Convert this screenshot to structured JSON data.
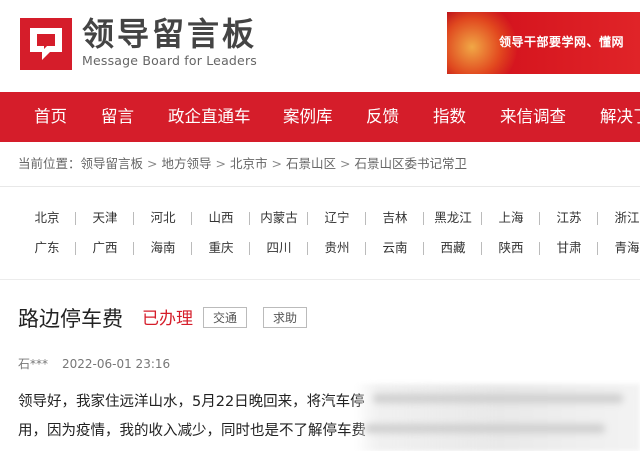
{
  "header": {
    "brand_name": "领导留言板",
    "brand_sub": "Message Board for Leaders",
    "banner_text": "领导干部要学网、懂网"
  },
  "nav": {
    "items": [
      {
        "label": "首页"
      },
      {
        "label": "留言"
      },
      {
        "label": "政企直通车"
      },
      {
        "label": "案例库"
      },
      {
        "label": "反馈"
      },
      {
        "label": "指数"
      },
      {
        "label": "来信调查"
      },
      {
        "label": "解决了"
      }
    ]
  },
  "breadcrumb": {
    "prefix": "当前位置：",
    "items": [
      {
        "label": "领导留言板"
      },
      {
        "label": "地方领导"
      },
      {
        "label": "北京市"
      },
      {
        "label": "石景山区"
      },
      {
        "label": "石景山区委书记常卫"
      }
    ]
  },
  "regions": {
    "row1": [
      "北京",
      "天津",
      "河北",
      "山西",
      "内蒙古",
      "辽宁",
      "吉林",
      "黑龙江",
      "上海",
      "江苏",
      "浙江"
    ],
    "row2": [
      "广东",
      "广西",
      "海南",
      "重庆",
      "四川",
      "贵州",
      "云南",
      "西藏",
      "陕西",
      "甘肃",
      "青海"
    ]
  },
  "post": {
    "title": "路边停车费",
    "status": "已办理",
    "tags": [
      {
        "label": "交通"
      },
      {
        "label": "求助"
      }
    ],
    "author": "石***",
    "date": "2022-06-01 23:16",
    "body_lines": [
      "领导好，我家住远洋山水，5月22日晚回来，将汽车停",
      "用，因为疫情，我的收入减少，同时也是不了解停车费"
    ]
  },
  "colors": {
    "brand_red": "#d51d2a",
    "status_red": "#d51d2a"
  }
}
